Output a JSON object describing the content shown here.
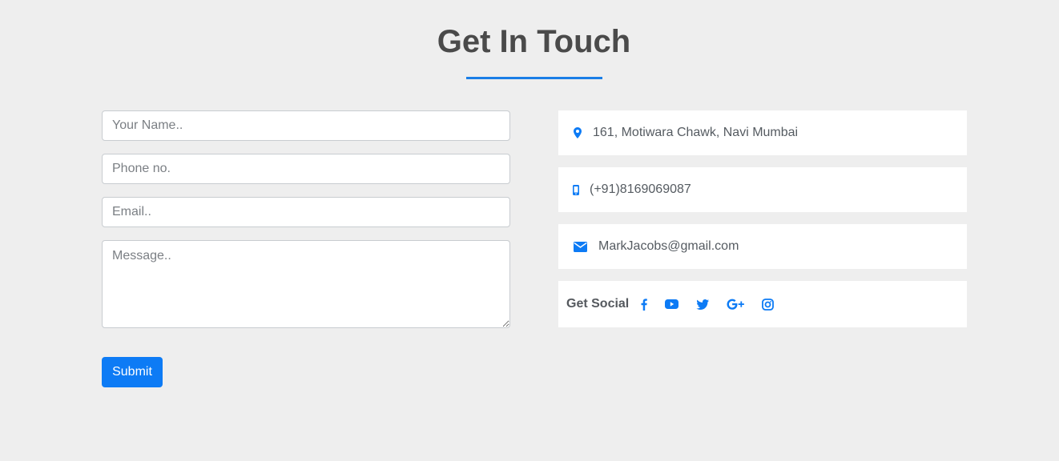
{
  "heading": "Get In Touch",
  "form": {
    "name_placeholder": "Your Name..",
    "phone_placeholder": "Phone no.",
    "email_placeholder": "Email..",
    "message_placeholder": "Message..",
    "submit_label": "Submit"
  },
  "contact": {
    "address": "161, Motiwara Chawk, Navi Mumbai",
    "phone": "(+91)8169069087",
    "email": "MarkJacobs@gmail.com"
  },
  "social": {
    "label": "Get Social",
    "icons": [
      "facebook-icon",
      "youtube-icon",
      "twitter-icon",
      "google-plus-icon",
      "instagram-icon"
    ]
  },
  "colors": {
    "accent": "#0d7bf5",
    "background": "#eeeeee",
    "heading": "#4a4a4a"
  }
}
